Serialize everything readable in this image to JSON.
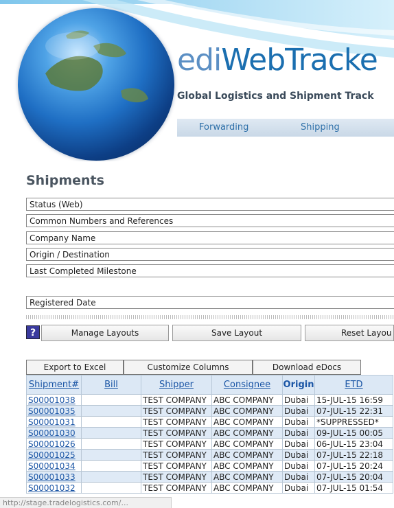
{
  "header": {
    "brand_prefix": "edi",
    "brand_main": "WebTracke",
    "tagline": "Global Logistics and Shipment Track",
    "nav": [
      "Forwarding",
      "Shipping"
    ]
  },
  "page_title": "Shipments",
  "filters": {
    "status": "Status (Web)",
    "numbers": "Common Numbers and References",
    "company": "Company Name",
    "origin": "Origin / Destination",
    "milestone": "Last Completed Milestone",
    "registered": "Registered Date"
  },
  "layout_buttons": {
    "help": "?",
    "manage": "Manage Layouts",
    "save": "Save Layout",
    "reset": "Reset Layou"
  },
  "grid_tabs": {
    "export": "Export to Excel",
    "customize": "Customize Columns",
    "download": "Download eDocs"
  },
  "table": {
    "columns": [
      "Shipment#",
      "Bill",
      "Shipper",
      "Consignee",
      "Origin",
      "ETD"
    ],
    "rows": [
      [
        "S00001038",
        "",
        "TEST COMPANY",
        "ABC COMPANY",
        "Dubai",
        "15-JUL-15 16:59"
      ],
      [
        "S00001035",
        "",
        "TEST COMPANY",
        "ABC COMPANY",
        "Dubai",
        "07-JUL-15 22:31"
      ],
      [
        "S00001031",
        "",
        "TEST COMPANY",
        "ABC COMPANY",
        "Dubai",
        "*SUPPRESSED*"
      ],
      [
        "S00001030",
        "",
        "TEST COMPANY",
        "ABC COMPANY",
        "Dubai",
        "09-JUL-15 00:05"
      ],
      [
        "S00001026",
        "",
        "TEST COMPANY",
        "ABC COMPANY",
        "Dubai",
        "06-JUL-15 23:04"
      ],
      [
        "S00001025",
        "",
        "TEST COMPANY",
        "ABC COMPANY",
        "Dubai",
        "07-JUL-15 22:18"
      ],
      [
        "S00001034",
        "",
        "TEST COMPANY",
        "ABC COMPANY",
        "Dubai",
        "07-JUL-15 20:24"
      ],
      [
        "S00001033",
        "",
        "TEST COMPANY",
        "ABC COMPANY",
        "Dubai",
        "07-JUL-15 20:04"
      ],
      [
        "S00001032",
        "",
        "TEST COMPANY",
        "ABC COMPANY",
        "Dubai",
        "07-JUL-15 01:54"
      ]
    ]
  },
  "statusbar": "http://stage.tradelogistics.com/...",
  "colors": {
    "link": "#1a55a5",
    "header_row": "#dce8f5",
    "alt_row": "#dfeaf6",
    "globe": "#1f6fc4"
  }
}
